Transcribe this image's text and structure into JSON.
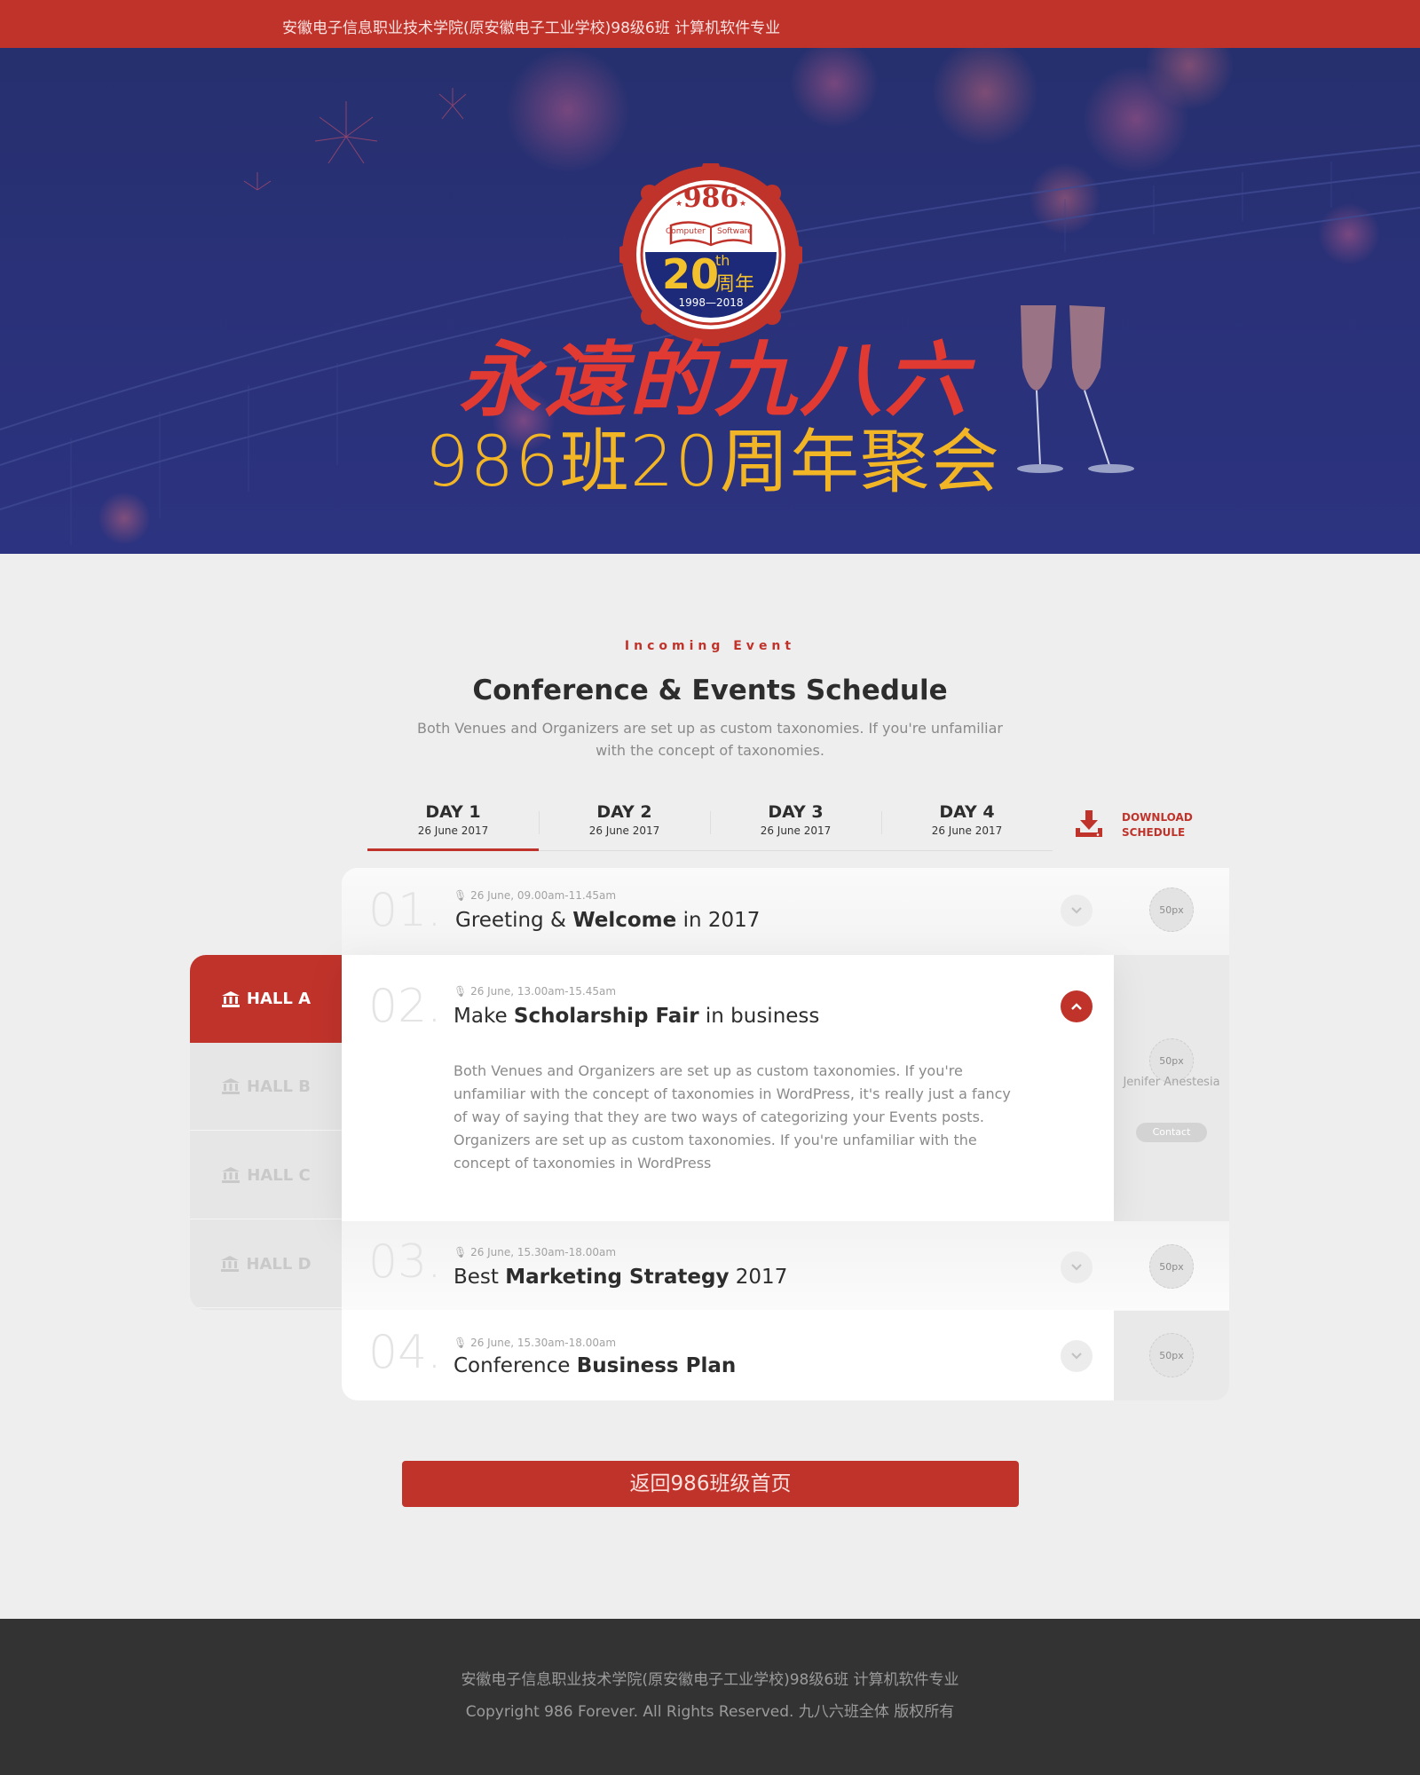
{
  "topbar": {
    "text": "安徽电子信息职业技术学院(原安徽电子工业学校)98级6班 计算机软件专业"
  },
  "hero": {
    "title": "永遠的九八六",
    "subtitle": "986班20周年聚会",
    "badge": {
      "number": "986",
      "tag_left": "Computer",
      "tag_right": "Software",
      "anniversary": "20",
      "suffix": "th",
      "zhou": "周年",
      "years": "1998—2018"
    }
  },
  "section": {
    "eyebrow": "Incoming Event",
    "title": "Conference & Events Schedule",
    "description": "Both Venues and Organizers are set up as custom taxonomies. If you're unfamiliar with the concept of taxonomies."
  },
  "tabs": [
    {
      "day": "DAY 1",
      "date": "26 June 2017"
    },
    {
      "day": "DAY 2",
      "date": "26 June 2017"
    },
    {
      "day": "DAY 3",
      "date": "26 June 2017"
    },
    {
      "day": "DAY 4",
      "date": "26 June 2017"
    }
  ],
  "download": {
    "line1": "DOWNLOAD",
    "line2": "SCHEDULE"
  },
  "halls": [
    "HALL A",
    "HALL B",
    "HALL C",
    "HALL D"
  ],
  "events": [
    {
      "num": "01.",
      "meta": "26 June, 09.00am-11.45am",
      "pre": "Greeting & ",
      "bold": "Welcome",
      "post": " in 2017",
      "avatar": "50px"
    },
    {
      "num": "02.",
      "meta": "26 June, 13.00am-15.45am",
      "pre": "Make ",
      "bold": "Scholarship Fair",
      "post": " in business",
      "avatar": "50px",
      "description": "Both Venues and Organizers are set up as custom taxonomies. If you're unfamiliar with the concept of taxonomies in WordPress, it's really just a fancy of way of saying that they are two ways of categorizing your Events posts. Organizers are set up as custom taxonomies. If you're unfamiliar with the concept of taxonomies in WordPress",
      "speaker": "Jenifer Anestesia",
      "contact": "Contact"
    },
    {
      "num": "03.",
      "meta": "26 June, 15.30am-18.00am",
      "pre": "Best ",
      "bold": "Marketing Strategy",
      "post": " 2017",
      "avatar": "50px"
    },
    {
      "num": "04.",
      "meta": "26 June, 15.30am-18.00am",
      "pre": "Conference ",
      "bold": "Business Plan",
      "post": "",
      "avatar": "50px"
    }
  ],
  "back_button": "返回986班级首页",
  "footer": {
    "line1": "安徽电子信息职业技术学院(原安徽电子工业学校)98级6班 计算机软件专业",
    "line2": "Copyright 986 Forever. All Rights Reserved. 九八六班全体 版权所有"
  },
  "colors": {
    "accent": "#c0332b",
    "hero_bg": "#2a3178",
    "gold": "#f1b526",
    "footer_bg": "#333333"
  }
}
